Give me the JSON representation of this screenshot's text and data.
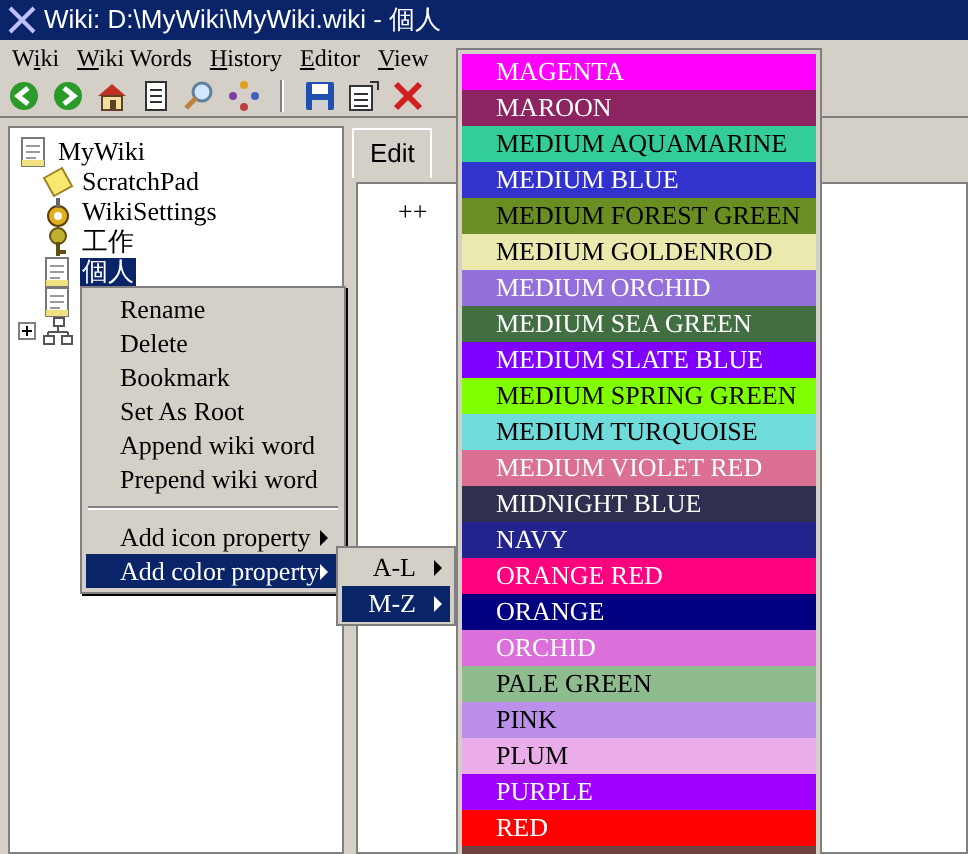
{
  "window": {
    "title": "Wiki: D:\\MyWiki\\MyWiki.wiki - 個人"
  },
  "menu_bar": [
    {
      "label": "Wiki"
    },
    {
      "label": "Wiki Words"
    },
    {
      "label": "History"
    },
    {
      "label": "Editor"
    },
    {
      "label": "View"
    }
  ],
  "tree": {
    "label": "MyWiki",
    "children": [
      {
        "kind": "note",
        "label": "ScratchPad",
        "selected": false
      },
      {
        "kind": "gears",
        "label": "WikiSettings",
        "selected": false
      },
      {
        "kind": "key",
        "label": "工作",
        "selected": false
      },
      {
        "kind": "page",
        "label": "個人",
        "selected": true
      },
      {
        "kind": "page"
      },
      {
        "kind": "network",
        "expanded": false
      }
    ]
  },
  "editor": {
    "tab": "Edit",
    "content": "++"
  },
  "context_menu": [
    {
      "kind": "item",
      "label": "Rename",
      "selected": false
    },
    {
      "kind": "item",
      "label": "Delete",
      "selected": false
    },
    {
      "kind": "item",
      "label": "Bookmark",
      "selected": false
    },
    {
      "kind": "item",
      "label": "Set As Root",
      "selected": false
    },
    {
      "kind": "item",
      "label": "Append wiki word",
      "selected": false
    },
    {
      "kind": "item",
      "label": "Prepend wiki word",
      "selected": false
    },
    {
      "kind": "separator"
    },
    {
      "kind": "submenu",
      "label": "Add icon property",
      "selected": false
    },
    {
      "kind": "submenu",
      "label": "Add color property",
      "selected": true
    }
  ],
  "submenu": [
    {
      "label": "A-L",
      "selected": false
    },
    {
      "label": "M-Z",
      "selected": true
    }
  ],
  "colors": [
    {
      "label": "MAGENTA",
      "color": "#ff00ff",
      "dark_text": false,
      "selected": false
    },
    {
      "label": "MAROON",
      "color": "#8e2361",
      "dark_text": false,
      "selected": false
    },
    {
      "label": "MEDIUM AQUAMARINE",
      "color": "#32cd99",
      "dark_text": true,
      "selected": false
    },
    {
      "label": "MEDIUM BLUE",
      "color": "#3232cd",
      "dark_text": false,
      "selected": false
    },
    {
      "label": "MEDIUM FOREST GREEN",
      "color": "#6b8e23",
      "dark_text": true,
      "selected": false
    },
    {
      "label": "MEDIUM GOLDENROD",
      "color": "#eaeaae",
      "dark_text": true,
      "selected": false
    },
    {
      "label": "MEDIUM ORCHID",
      "color": "#9370db",
      "dark_text": false,
      "selected": false
    },
    {
      "label": "MEDIUM SEA GREEN",
      "color": "#426f42",
      "dark_text": false,
      "selected": false
    },
    {
      "label": "MEDIUM SLATE BLUE",
      "color": "#7f00ff",
      "dark_text": false,
      "selected": false
    },
    {
      "label": "MEDIUM SPRING GREEN",
      "color": "#7fff00",
      "dark_text": true,
      "selected": false
    },
    {
      "label": "MEDIUM TURQUOISE",
      "color": "#70dbdb",
      "dark_text": true,
      "selected": false
    },
    {
      "label": "MEDIUM VIOLET RED",
      "color": "#db7093",
      "dark_text": false,
      "selected": false
    },
    {
      "label": "MIDNIGHT BLUE",
      "color": "#2f2f4f",
      "dark_text": false,
      "selected": false
    },
    {
      "label": "NAVY",
      "color": "#23238e",
      "dark_text": false,
      "selected": false
    },
    {
      "label": "ORANGE RED",
      "color": "#ff007f",
      "dark_text": false,
      "selected": false
    },
    {
      "label": "ORANGE",
      "dark_text": false,
      "selected": true
    },
    {
      "label": "ORCHID",
      "color": "#db70db",
      "dark_text": false,
      "selected": false
    },
    {
      "label": "PALE GREEN",
      "color": "#8fbc8f",
      "dark_text": true,
      "selected": false
    },
    {
      "label": "PINK",
      "color": "#bc8fea",
      "dark_text": true,
      "selected": false
    },
    {
      "label": "PLUM",
      "color": "#eaadea",
      "dark_text": true,
      "selected": false
    },
    {
      "label": "PURPLE",
      "color": "#9f00ff",
      "dark_text": false,
      "selected": false
    },
    {
      "label": "RED",
      "color": "#ff0000",
      "dark_text": false,
      "selected": false
    },
    {
      "color": "#6f4242",
      "selected": false
    }
  ]
}
